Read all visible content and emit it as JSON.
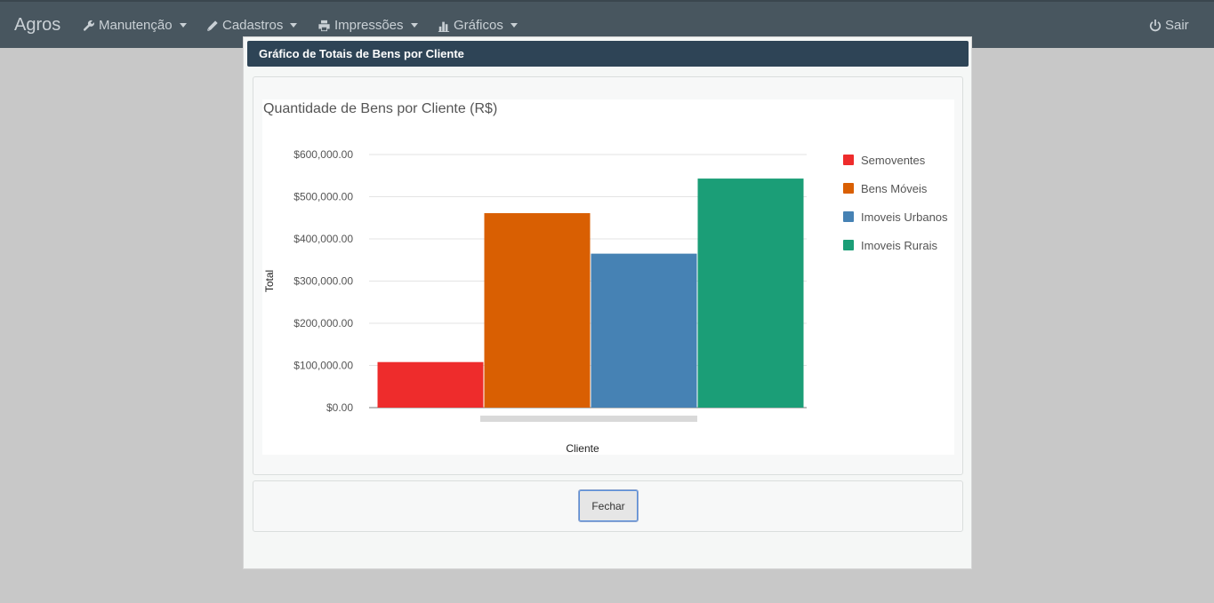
{
  "navbar": {
    "brand": "Agros",
    "items": [
      {
        "label": "Manutenção",
        "icon": "wrench-icon"
      },
      {
        "label": "Cadastros",
        "icon": "pencil-icon"
      },
      {
        "label": "Impressões",
        "icon": "print-icon"
      },
      {
        "label": "Gráficos",
        "icon": "bar-chart-icon"
      }
    ],
    "logout_label": "Sair",
    "logout_icon": "power-icon"
  },
  "modal": {
    "title": "Gráfico de Totais de Bens por Cliente",
    "close_label": "Fechar"
  },
  "chart_data": {
    "type": "bar",
    "title": "Quantidade de Bens por Cliente (R$)",
    "xlabel": "Cliente",
    "ylabel": "Total",
    "ylim": [
      0,
      600000
    ],
    "yticks": [
      "$0.00",
      "$100,000.00",
      "$200,000.00",
      "$300,000.00",
      "$400,000.00",
      "$500,000.00",
      "$600,000.00"
    ],
    "categories": [
      ""
    ],
    "series": [
      {
        "name": "Semoventes",
        "values": [
          108000
        ],
        "color": "#ee2c2c"
      },
      {
        "name": "Bens Móveis",
        "values": [
          461000
        ],
        "color": "#d95f02"
      },
      {
        "name": "Imoveis Urbanos",
        "values": [
          365000
        ],
        "color": "#4682b4"
      },
      {
        "name": "Imoveis Rurais",
        "values": [
          543000
        ],
        "color": "#1b9e77"
      }
    ],
    "grid": true,
    "legend": "right"
  }
}
